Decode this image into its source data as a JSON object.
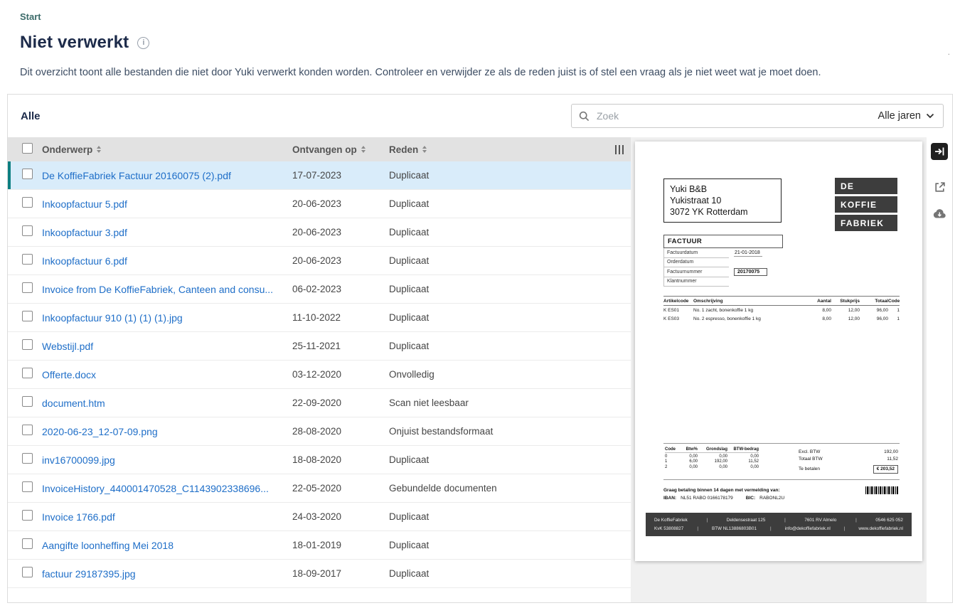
{
  "colors": {
    "accent_teal": "#0d7f81",
    "link_blue": "#1e6ec8",
    "selected_row_bg": "#d9ecfa",
    "table_header_bg": "#e2e2e2",
    "title_navy": "#1d2b4a"
  },
  "breadcrumb": {
    "label": "Start"
  },
  "page": {
    "title": "Niet verwerkt",
    "description": "Dit overzicht toont alle bestanden die niet door Yuki verwerkt konden worden. Controleer en verwijder ze als de reden juist is of stel een vraag als je niet weet wat je moet doen."
  },
  "filters": {
    "tab_label": "Alle",
    "search_placeholder": "Zoek",
    "year_filter_label": "Alle jaren"
  },
  "icons": {
    "info_icon": "i",
    "search_icon": "magnifier",
    "chevron_down_icon": "chevron-down",
    "sort_icon": "sort-arrows",
    "columns_icon": "column-selector",
    "collapse_icon": "arrow-to-bar",
    "open_icon": "open-in-new",
    "download_icon": "cloud-download"
  },
  "table": {
    "columns": {
      "subject": "Onderwerp",
      "received": "Ontvangen op",
      "reason": "Reden"
    },
    "rows": [
      {
        "subject": "De KoffieFabriek Factuur 20160075 (2).pdf",
        "received": "17-07-2023",
        "reason": "Duplicaat",
        "selected": true
      },
      {
        "subject": "Inkoopfactuur 5.pdf",
        "received": "20-06-2023",
        "reason": "Duplicaat",
        "selected": false
      },
      {
        "subject": "Inkoopfactuur 3.pdf",
        "received": "20-06-2023",
        "reason": "Duplicaat",
        "selected": false
      },
      {
        "subject": "Inkoopfactuur 6.pdf",
        "received": "20-06-2023",
        "reason": "Duplicaat",
        "selected": false
      },
      {
        "subject": "Invoice from De KoffieFabriek, Canteen and consu...",
        "received": "06-02-2023",
        "reason": "Duplicaat",
        "selected": false
      },
      {
        "subject": "Inkoopfactuur 910 (1) (1) (1).jpg",
        "received": "11-10-2022",
        "reason": "Duplicaat",
        "selected": false
      },
      {
        "subject": "Webstijl.pdf",
        "received": "25-11-2021",
        "reason": "Duplicaat",
        "selected": false
      },
      {
        "subject": "Offerte.docx",
        "received": "03-12-2020",
        "reason": "Onvolledig",
        "selected": false
      },
      {
        "subject": "document.htm",
        "received": "22-09-2020",
        "reason": "Scan niet leesbaar",
        "selected": false
      },
      {
        "subject": "2020-06-23_12-07-09.png",
        "received": "28-08-2020",
        "reason": "Onjuist bestandsformaat",
        "selected": false
      },
      {
        "subject": "inv16700099.jpg",
        "received": "18-08-2020",
        "reason": "Duplicaat",
        "selected": false
      },
      {
        "subject": "InvoiceHistory_440001470528_C1143902338696...",
        "received": "22-05-2020",
        "reason": "Gebundelde documenten",
        "selected": false
      },
      {
        "subject": "Invoice 1766.pdf",
        "received": "24-03-2020",
        "reason": "Duplicaat",
        "selected": false
      },
      {
        "subject": "Aangifte loonheffing Mei 2018",
        "received": "18-01-2019",
        "reason": "Duplicaat",
        "selected": false
      },
      {
        "subject": "factuur 29187395.jpg",
        "received": "18-09-2017",
        "reason": "Duplicaat",
        "selected": false
      }
    ]
  },
  "preview": {
    "recipient_lines": [
      "Yuki B&B",
      "Yukistraat 10",
      "3072 YK Rotterdam"
    ],
    "logo_lines": [
      "DE",
      "KOFFIE",
      "FABRIEK"
    ],
    "invoice_header": "FACTUUR",
    "meta": [
      {
        "label": "Factuurdatum",
        "value": "21-01-2018"
      },
      {
        "label": "Orderdatum",
        "value": ""
      },
      {
        "label": "Factuurnummer",
        "value": "20170075"
      },
      {
        "label": "Klantnummer",
        "value": ""
      }
    ],
    "items_columns": [
      "Artikelcode",
      "Omschrijving",
      "Aantal",
      "Stukprijs",
      "Totaal",
      "Code"
    ],
    "items": [
      {
        "code": "K ES01",
        "description": "No. 1 zacht, bonenkoffie 1 kg",
        "qty": "8,00",
        "price": "12,00",
        "total": "96,00",
        "vat": "1"
      },
      {
        "code": "K ES03",
        "description": "No. 2 espresso, bonenkoffie 1 kg",
        "qty": "8,00",
        "price": "12,00",
        "total": "96,00",
        "vat": "1"
      }
    ],
    "vat_columns": [
      "Code",
      "Btw%",
      "Grondslag",
      "BTW-bedrag"
    ],
    "vat_rows": [
      {
        "code": "0",
        "pct": "0,00",
        "base": "0,00",
        "amount": "0,00"
      },
      {
        "code": "1",
        "pct": "6,00",
        "base": "192,00",
        "amount": "11,52"
      },
      {
        "code": "2",
        "pct": "0,00",
        "base": "0,00",
        "amount": "0,00"
      }
    ],
    "totals": [
      {
        "label": "Excl. BTW",
        "value": "192,00"
      },
      {
        "label": "Totaal BTW",
        "value": "11,52"
      },
      {
        "label": "Te betalen",
        "value": "€  203,52"
      }
    ],
    "payment_note": "Graag betaling binnen 14 dagen met vermelding van:",
    "payment": {
      "iban_label": "IBAN:",
      "iban": "NL51 RABO 0166178179",
      "bic_label": "BIC:",
      "bic": "RABONL2U"
    },
    "footer_line1": [
      "De KoffieFabriek",
      "Deldensestraat 125",
      "7601 RV Almelo",
      "0546 625 052"
    ],
    "footer_line2": [
      "KvK 53808827",
      "BTW NL13886803B01",
      "info@dekoffiefabriek.nl",
      "www.dekoffiefabriek.nl"
    ]
  }
}
